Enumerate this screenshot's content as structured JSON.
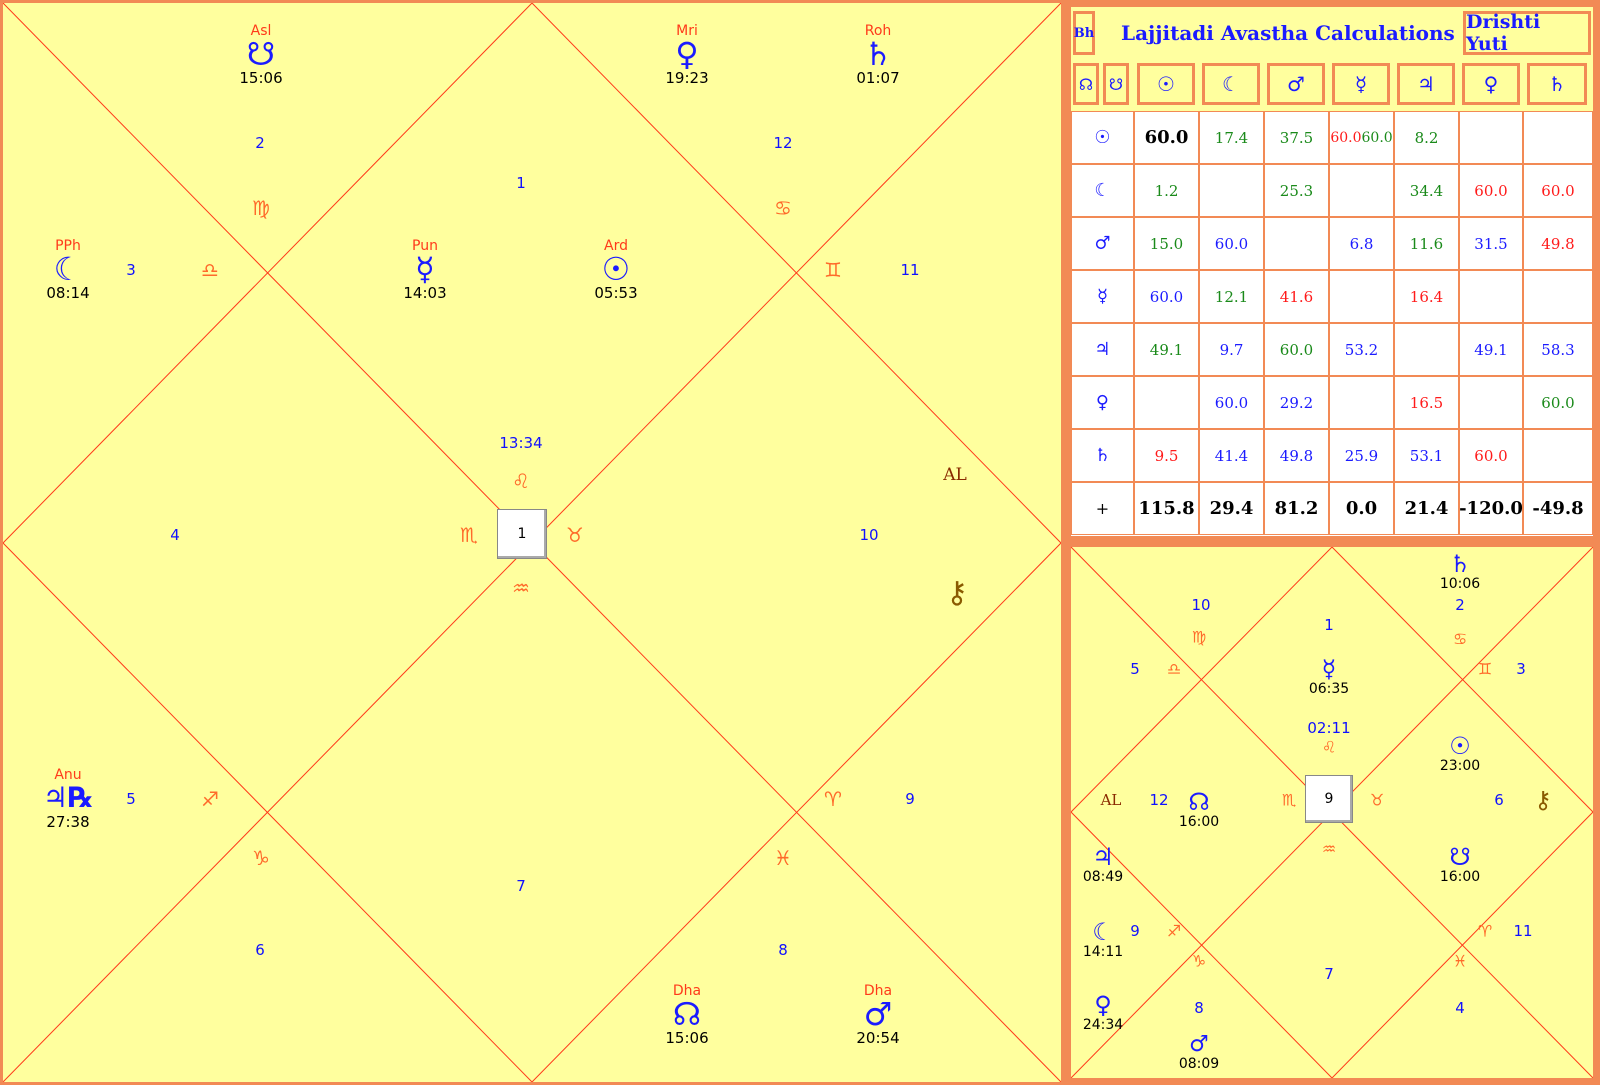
{
  "main_chart": {
    "center": {
      "label": "1",
      "time": "13:34"
    },
    "houses": [
      "1",
      "2",
      "3",
      "4",
      "5",
      "6",
      "7",
      "8",
      "9",
      "10",
      "11",
      "12"
    ],
    "signs": [
      "♑",
      "♍",
      "♎",
      "♐",
      "♑",
      "♒",
      "♓",
      "♈",
      "♊",
      "♋",
      "♌",
      "♏"
    ],
    "lagna_signs": {
      "top": "♌",
      "left": "♏",
      "right": "♉",
      "bottom": "♒"
    },
    "planets": [
      {
        "nak": "Asl",
        "glyph": "☋",
        "deg": "15:06"
      },
      {
        "nak": "Mri",
        "glyph": "♀",
        "deg": "19:23"
      },
      {
        "nak": "Roh",
        "glyph": "♄",
        "deg": "01:07"
      },
      {
        "nak": "PPh",
        "glyph": "☾",
        "deg": "08:14"
      },
      {
        "nak": "Pun",
        "glyph": "☿",
        "deg": "14:03"
      },
      {
        "nak": "Ard",
        "glyph": "☉",
        "deg": "05:53"
      },
      {
        "nak": "Anu",
        "glyph": "♃℞",
        "deg": "27:38"
      },
      {
        "nak": "Dha",
        "glyph": "☊",
        "deg": "15:06"
      },
      {
        "nak": "Dha",
        "glyph": "♂",
        "deg": "20:54"
      }
    ],
    "extras": {
      "al": "AL",
      "chiron": "⚷"
    }
  },
  "avastha": {
    "bh_button": "Bh",
    "title": "Lajjitadi Avastha Calculations",
    "drishti_button": "Drishti Yuti",
    "header_icons": [
      "☊",
      "☋",
      "☉",
      "☾",
      "♂",
      "☿",
      "♃",
      "♀",
      "♄"
    ],
    "row_icons": [
      "☉",
      "☾",
      "♂",
      "☿",
      "♃",
      "♀",
      "♄"
    ],
    "rows": [
      [
        {
          "v": "60.0",
          "c": "#000",
          "b": true
        },
        {
          "v": "17.4",
          "c": "#1a8a1a"
        },
        {
          "v": "37.5",
          "c": "#1a8a1a"
        },
        {
          "v": "60.0",
          "c": "#ff1a1a",
          "v2": "60.0",
          "c2": "#1a8a1a"
        },
        {
          "v": "8.2",
          "c": "#1a8a1a"
        },
        {
          "v": "",
          "c": "#000"
        },
        {
          "v": "",
          "c": "#000"
        }
      ],
      [
        {
          "v": "1.2",
          "c": "#1a8a1a"
        },
        {
          "v": "",
          "c": "#000"
        },
        {
          "v": "25.3",
          "c": "#1a8a1a"
        },
        {
          "v": "",
          "c": "#000"
        },
        {
          "v": "34.4",
          "c": "#1a8a1a"
        },
        {
          "v": "60.0",
          "c": "#ff1a1a"
        },
        {
          "v": "60.0",
          "c": "#ff1a1a"
        }
      ],
      [
        {
          "v": "15.0",
          "c": "#1a8a1a"
        },
        {
          "v": "60.0",
          "c": "#1b1bff"
        },
        {
          "v": "",
          "c": "#000"
        },
        {
          "v": "6.8",
          "c": "#1b1bff"
        },
        {
          "v": "11.6",
          "c": "#1a8a1a"
        },
        {
          "v": "31.5",
          "c": "#1b1bff"
        },
        {
          "v": "49.8",
          "c": "#ff1a1a"
        }
      ],
      [
        {
          "v": "60.0",
          "c": "#1b1bff"
        },
        {
          "v": "12.1",
          "c": "#1a8a1a"
        },
        {
          "v": "41.6",
          "c": "#ff1a1a"
        },
        {
          "v": "",
          "c": "#000"
        },
        {
          "v": "16.4",
          "c": "#ff1a1a"
        },
        {
          "v": "",
          "c": "#000"
        },
        {
          "v": "",
          "c": "#000"
        }
      ],
      [
        {
          "v": "49.1",
          "c": "#1a8a1a"
        },
        {
          "v": "9.7",
          "c": "#1b1bff"
        },
        {
          "v": "60.0",
          "c": "#1a8a1a"
        },
        {
          "v": "53.2",
          "c": "#1b1bff"
        },
        {
          "v": "",
          "c": "#000"
        },
        {
          "v": "49.1",
          "c": "#1b1bff"
        },
        {
          "v": "58.3",
          "c": "#1b1bff"
        }
      ],
      [
        {
          "v": "",
          "c": "#000"
        },
        {
          "v": "60.0",
          "c": "#1b1bff"
        },
        {
          "v": "29.2",
          "c": "#1b1bff"
        },
        {
          "v": "",
          "c": "#000"
        },
        {
          "v": "16.5",
          "c": "#ff1a1a"
        },
        {
          "v": "",
          "c": "#000"
        },
        {
          "v": "60.0",
          "c": "#1a8a1a"
        }
      ],
      [
        {
          "v": "9.5",
          "c": "#ff1a1a"
        },
        {
          "v": "41.4",
          "c": "#1b1bff"
        },
        {
          "v": "49.8",
          "c": "#1b1bff"
        },
        {
          "v": "25.9",
          "c": "#1b1bff"
        },
        {
          "v": "53.1",
          "c": "#1b1bff"
        },
        {
          "v": "60.0",
          "c": "#ff1a1a"
        },
        {
          "v": "",
          "c": "#000"
        }
      ]
    ],
    "total_label": "+",
    "totals": [
      "115.8",
      "29.4",
      "81.2",
      "0.0",
      "21.4",
      "-120.0",
      "-49.8"
    ]
  },
  "small_chart": {
    "center": {
      "label": "9",
      "time": "02:11"
    },
    "houses": [
      "10",
      "1",
      "2",
      "5",
      "3",
      "12",
      "6",
      "9",
      "11",
      "8",
      "7",
      "4"
    ],
    "signs": [
      "♍",
      "♋",
      "♎",
      "♊",
      "♏",
      "♌",
      "♉",
      "♒",
      "♐",
      "♈",
      "♑",
      "♓"
    ],
    "planets": [
      {
        "glyph": "♄",
        "deg": "10:06"
      },
      {
        "glyph": "☿",
        "deg": "06:35"
      },
      {
        "glyph": "☉",
        "deg": "23:00"
      },
      {
        "glyph": "☊",
        "deg": "16:00"
      },
      {
        "glyph": "♃",
        "deg": "08:49"
      },
      {
        "glyph": "☋",
        "deg": "16:00"
      },
      {
        "glyph": "☾",
        "deg": "14:11"
      },
      {
        "glyph": "♀",
        "deg": "24:34"
      },
      {
        "glyph": "♂",
        "deg": "08:09"
      }
    ],
    "extras": {
      "al": "AL",
      "chiron": "⚷"
    }
  },
  "colors": {
    "chart_bg": "#ffff9e",
    "border": "#f28a55",
    "line": "#ff3a1a",
    "planet": "#1b1bff",
    "house_num": "#1010ff"
  }
}
